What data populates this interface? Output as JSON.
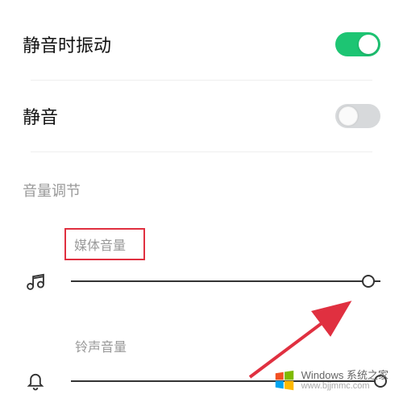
{
  "settings": {
    "vibrate_on_silent": {
      "label": "静音时振动",
      "enabled": true
    },
    "mute": {
      "label": "静音",
      "enabled": false
    }
  },
  "section": {
    "volume_header": "音量调节"
  },
  "volumes": {
    "media": {
      "label": "媒体音量",
      "value": 96
    },
    "ringtone": {
      "label": "铃声音量",
      "value": 100
    }
  },
  "watermark": {
    "brand": "Windows 系统之家",
    "url": "www.bjjmmc.com"
  },
  "colors": {
    "toggle_on": "#1dc573",
    "highlight": "#e03040",
    "arrow": "#e03040"
  }
}
